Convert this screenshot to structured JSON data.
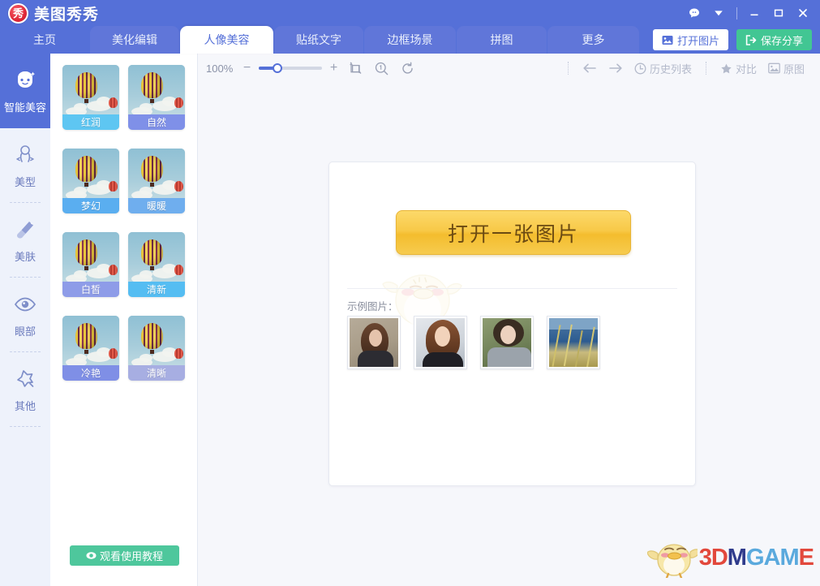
{
  "window": {
    "app_title": "美图秀秀",
    "logo_glyph": "秀",
    "controls": {
      "message_icon": "chat-bubble-icon",
      "dropdown_icon": "chevron-down-icon",
      "minimize": "minimize-icon",
      "maximize": "maximize-icon",
      "close": "close-icon"
    }
  },
  "tabs": [
    {
      "label": "主页",
      "active": false
    },
    {
      "label": "美化编辑",
      "active": false
    },
    {
      "label": "人像美容",
      "active": true
    },
    {
      "label": "贴纸文字",
      "active": false
    },
    {
      "label": "边框场景",
      "active": false
    },
    {
      "label": "拼图",
      "active": false
    },
    {
      "label": "更多",
      "active": false
    }
  ],
  "header_buttons": {
    "open_image": {
      "label": "打开图片",
      "icon": "image-icon",
      "bg": "#ffffff",
      "fg": "#5570d8"
    },
    "save_share": {
      "label": "保存分享",
      "icon": "export-icon",
      "bg": "#42c693",
      "fg": "#ffffff"
    }
  },
  "sidebar": {
    "items": [
      {
        "label": "智能美容",
        "icon": "face-beauty-icon",
        "active": true
      },
      {
        "label": "美型",
        "icon": "body-shape-icon",
        "active": false
      },
      {
        "label": "美肤",
        "icon": "brush-icon",
        "active": false
      },
      {
        "label": "眼部",
        "icon": "eye-icon",
        "active": false
      },
      {
        "label": "其他",
        "icon": "sparkle-star-icon",
        "active": false
      }
    ]
  },
  "presets": {
    "items": [
      {
        "label": "红润",
        "label_bg": "#5ec6f2"
      },
      {
        "label": "自然",
        "label_bg": "#7f90e8"
      },
      {
        "label": "梦幻",
        "label_bg": "#5aaef0"
      },
      {
        "label": "暖暖",
        "label_bg": "#6faeee"
      },
      {
        "label": "白皙",
        "label_bg": "#8e9ce8"
      },
      {
        "label": "清新",
        "label_bg": "#55bdf2"
      },
      {
        "label": "冷艳",
        "label_bg": "#7f8fe6"
      },
      {
        "label": "清晰",
        "label_bg": "#a7aee2"
      }
    ],
    "tutorial_button": {
      "label": "观看使用教程",
      "icon": "eye-play-icon",
      "bg": "#4ec79c"
    }
  },
  "toolbar": {
    "zoom_percent": "100%",
    "zoom_out_icon": "minus-icon",
    "zoom_in_icon": "plus-icon",
    "slider_value": 22,
    "crop_icon": "crop-icon",
    "magnifier_icon": "magnifier-one-icon",
    "rotate_icon": "rotate-refresh-icon",
    "undo_icon": "arrow-left-icon",
    "redo_icon": "arrow-right-icon",
    "history": {
      "label": "历史列表",
      "icon": "clock-icon"
    },
    "compare": {
      "label": "对比",
      "icon": "star-icon"
    },
    "original": {
      "label": "原图",
      "icon": "picture-icon"
    }
  },
  "canvas": {
    "open_button_label": "打开一张图片",
    "samples_label": "示例图片：",
    "samples": [
      {
        "name": "sample-portrait-1"
      },
      {
        "name": "sample-portrait-2"
      },
      {
        "name": "sample-portrait-3"
      },
      {
        "name": "sample-landscape-4"
      }
    ],
    "mascot_icon": "chick-mascot-watermark"
  },
  "watermark": {
    "letters": [
      "3",
      "D",
      "M",
      "G",
      "A",
      "M",
      "E"
    ],
    "mascot_icon": "chick-mascot-icon"
  }
}
